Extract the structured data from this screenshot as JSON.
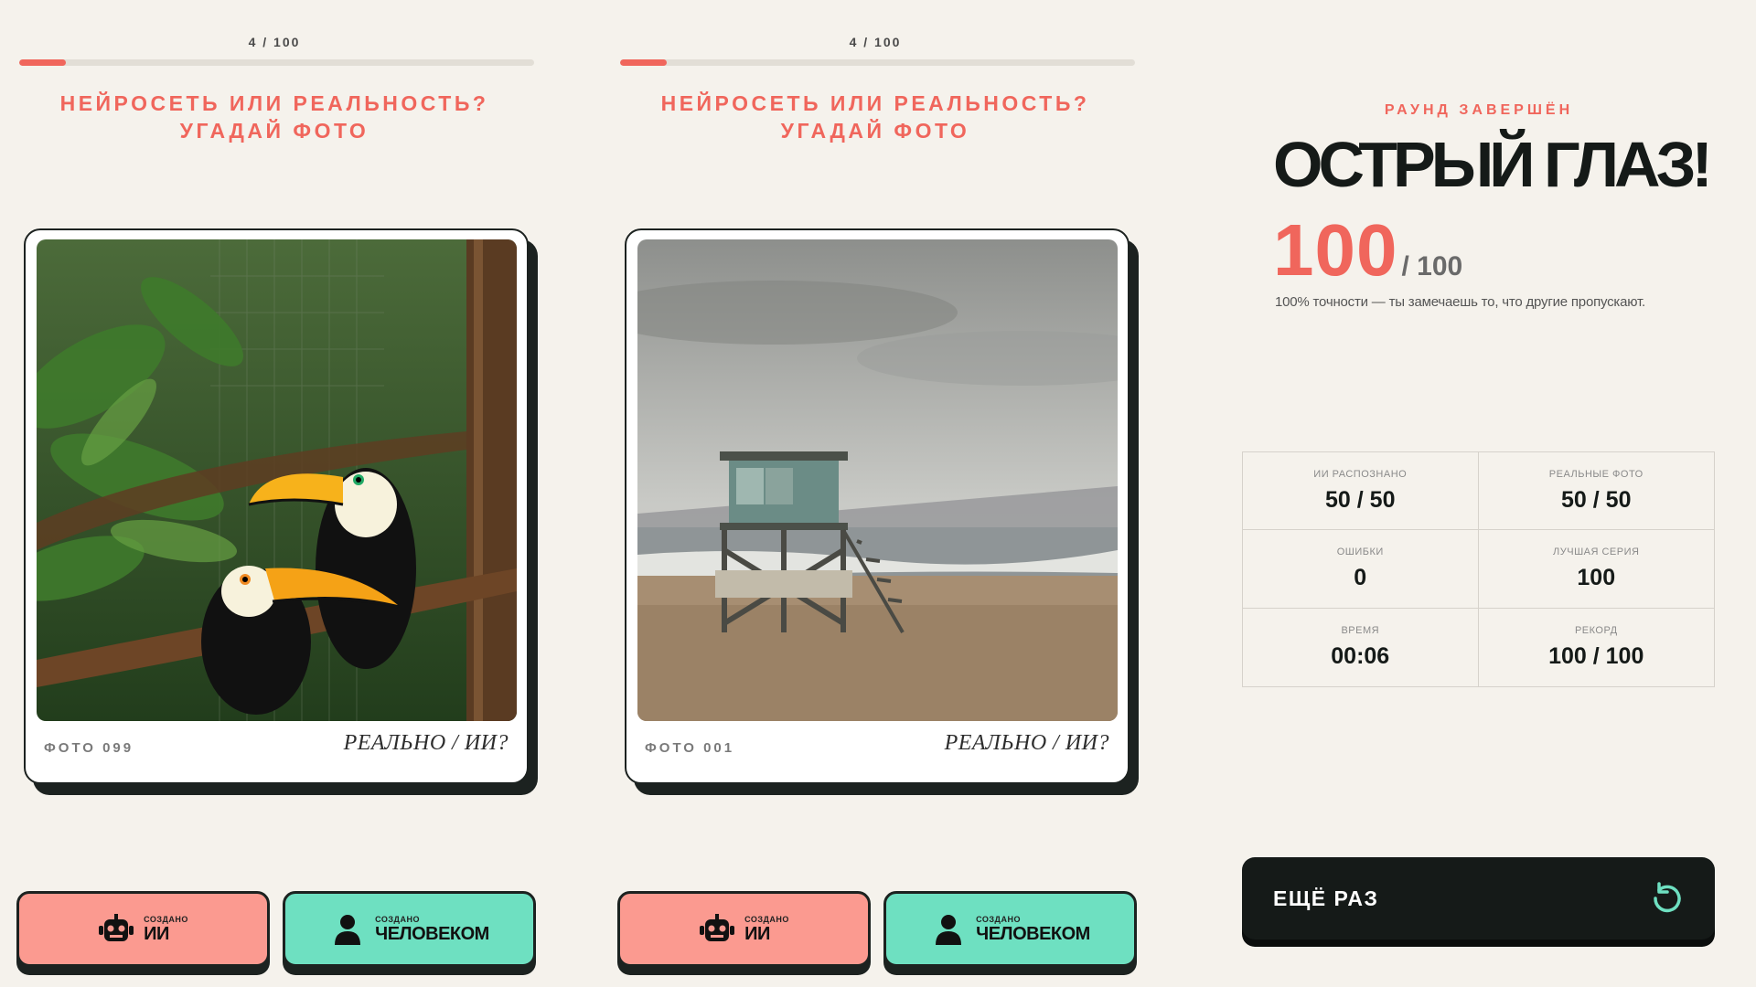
{
  "panels": [
    {
      "counter": "4 / 100",
      "progress": 0.09,
      "headline": [
        "НЕЙРОСЕТЬ ИЛИ РЕАЛЬНОСТЬ?",
        "УГАДАЙ ФОТО"
      ],
      "photo_id": "ФОТО 099",
      "question": "РЕАЛЬНО / ИИ?",
      "photo_subject": "two toucans on a branch in jungle",
      "btn_ai": {
        "small": "СОЗДАНО",
        "big": "ИИ",
        "icon": "robot-icon"
      },
      "btn_human": {
        "small": "СОЗДАНО",
        "big": "ЧЕЛОВЕКОМ",
        "icon": "person-icon"
      }
    },
    {
      "counter": "4 / 100",
      "progress": 0.09,
      "headline": [
        "НЕЙРОСЕТЬ ИЛИ РЕАЛЬНОСТЬ?",
        "УГАДАЙ ФОТО"
      ],
      "photo_id": "ФОТО 001",
      "question": "РЕАЛЬНО / ИИ?",
      "photo_subject": "lifeguard tower on a beach",
      "btn_ai": {
        "small": "СОЗДАНО",
        "big": "ИИ",
        "icon": "robot-icon"
      },
      "btn_human": {
        "small": "СОЗДАНО",
        "big": "ЧЕЛОВЕКОМ",
        "icon": "person-icon"
      }
    }
  ],
  "results": {
    "round_done": "РАУНД ЗАВЕРШЁН",
    "verdict": "ОСТРЫЙ ГЛАЗ!",
    "score": "100",
    "score_total": "/ 100",
    "note": "100% точности — ты замечаешь то, что другие пропускают.",
    "stats": [
      {
        "label": "ИИ РАСПОЗНАНО",
        "value": "50 / 50"
      },
      {
        "label": "РЕАЛЬНЫЕ ФОТО",
        "value": "50 / 50"
      },
      {
        "label": "ОШИБКИ",
        "value": "0"
      },
      {
        "label": "ЛУЧШАЯ СЕРИЯ",
        "value": "100"
      },
      {
        "label": "ВРЕМЯ",
        "value": "00:06"
      },
      {
        "label": "РЕКОРД",
        "value": "100 / 100"
      }
    ],
    "again_label": "ЕЩЁ РАЗ",
    "again_icon": "restart-icon"
  },
  "colors": {
    "accent": "#f0665c",
    "ai_button": "#fb9a90",
    "human_button": "#6ee0c1",
    "dark": "#151a18",
    "background": "#f5f2ec"
  }
}
